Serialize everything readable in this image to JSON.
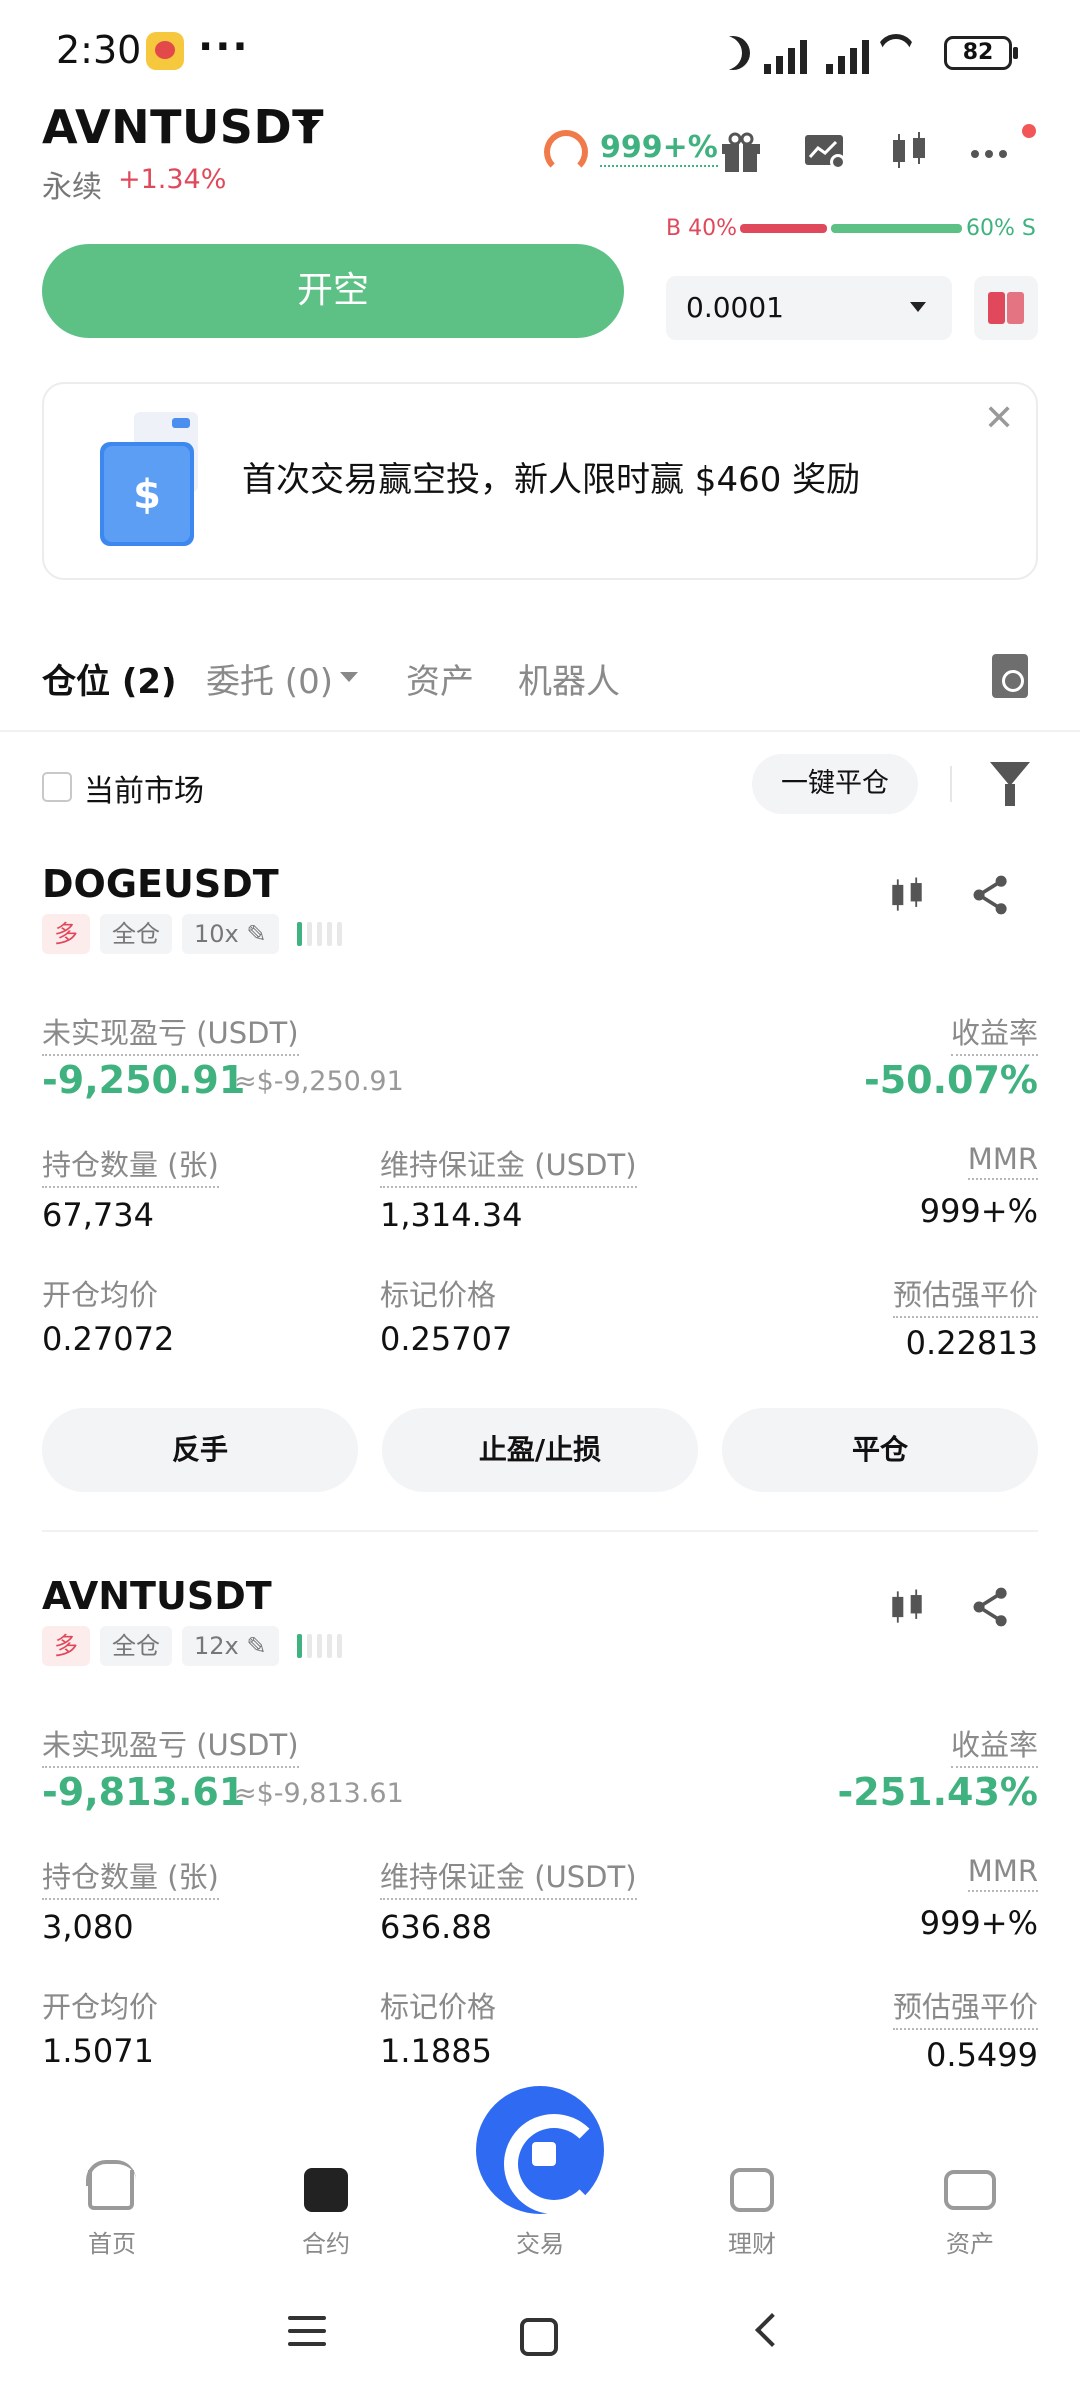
{
  "status_bar": {
    "time": "2:30",
    "more": "···",
    "battery": "82"
  },
  "header": {
    "pair": "AVNTUSDT",
    "perp_label": "永续",
    "change": "+1.34%",
    "risk_rate": "999+%",
    "icons": [
      "gift-icon",
      "chart-settings-icon",
      "candlestick-icon",
      "more-icon"
    ]
  },
  "orderbook": {
    "buy_ratio": "B 40%",
    "sell_ratio": "60% S",
    "buy_fraction": 0.4,
    "depth_value": "0.0001"
  },
  "open_short_label": "开空",
  "promo": {
    "text": "首次交易赢空投，新人限时赢 $460 奖励",
    "close": "✕"
  },
  "tabs": [
    {
      "label": "仓位 (2)",
      "active": true
    },
    {
      "label": "委托 (0)",
      "active": false
    },
    {
      "label": "资产",
      "active": false
    },
    {
      "label": "机器人",
      "active": false
    }
  ],
  "filter": {
    "current_market": "当前市场",
    "close_all": "一键平仓"
  },
  "labels": {
    "unrealized": "未实现盈亏 (USDT)",
    "roe": "收益率",
    "size": "持仓数量 (张)",
    "margin": "维持保证金 (USDT)",
    "mmr": "MMR",
    "entry": "开仓均价",
    "mark": "标记价格",
    "liq": "预估强平价",
    "long": "多",
    "cross": "全仓"
  },
  "positions": [
    {
      "symbol": "DOGEUSDT",
      "leverage": "10x",
      "pnl": "-9,250.91",
      "pnl_approx": "≈$-9,250.91",
      "roe": "-50.07%",
      "size": "67,734",
      "margin": "1,314.34",
      "mmr": "999+%",
      "entry": "0.27072",
      "mark": "0.25707",
      "liq": "0.22813",
      "actions": [
        "反手",
        "止盈/止损",
        "平仓"
      ]
    },
    {
      "symbol": "AVNTUSDT",
      "leverage": "12x",
      "pnl": "-9,813.61",
      "pnl_approx": "≈$-9,813.61",
      "roe": "-251.43%",
      "size": "3,080",
      "margin": "636.88",
      "mmr": "999+%",
      "entry": "1.5071",
      "mark": "1.1885",
      "liq": "0.5499"
    }
  ],
  "nav": [
    {
      "label": "首页",
      "icon": "home-icon"
    },
    {
      "label": "合约",
      "icon": "contract-icon"
    },
    {
      "label": "交易",
      "icon": "trade-icon"
    },
    {
      "label": "理财",
      "icon": "finance-icon"
    },
    {
      "label": "资产",
      "icon": "wallet-icon"
    }
  ]
}
